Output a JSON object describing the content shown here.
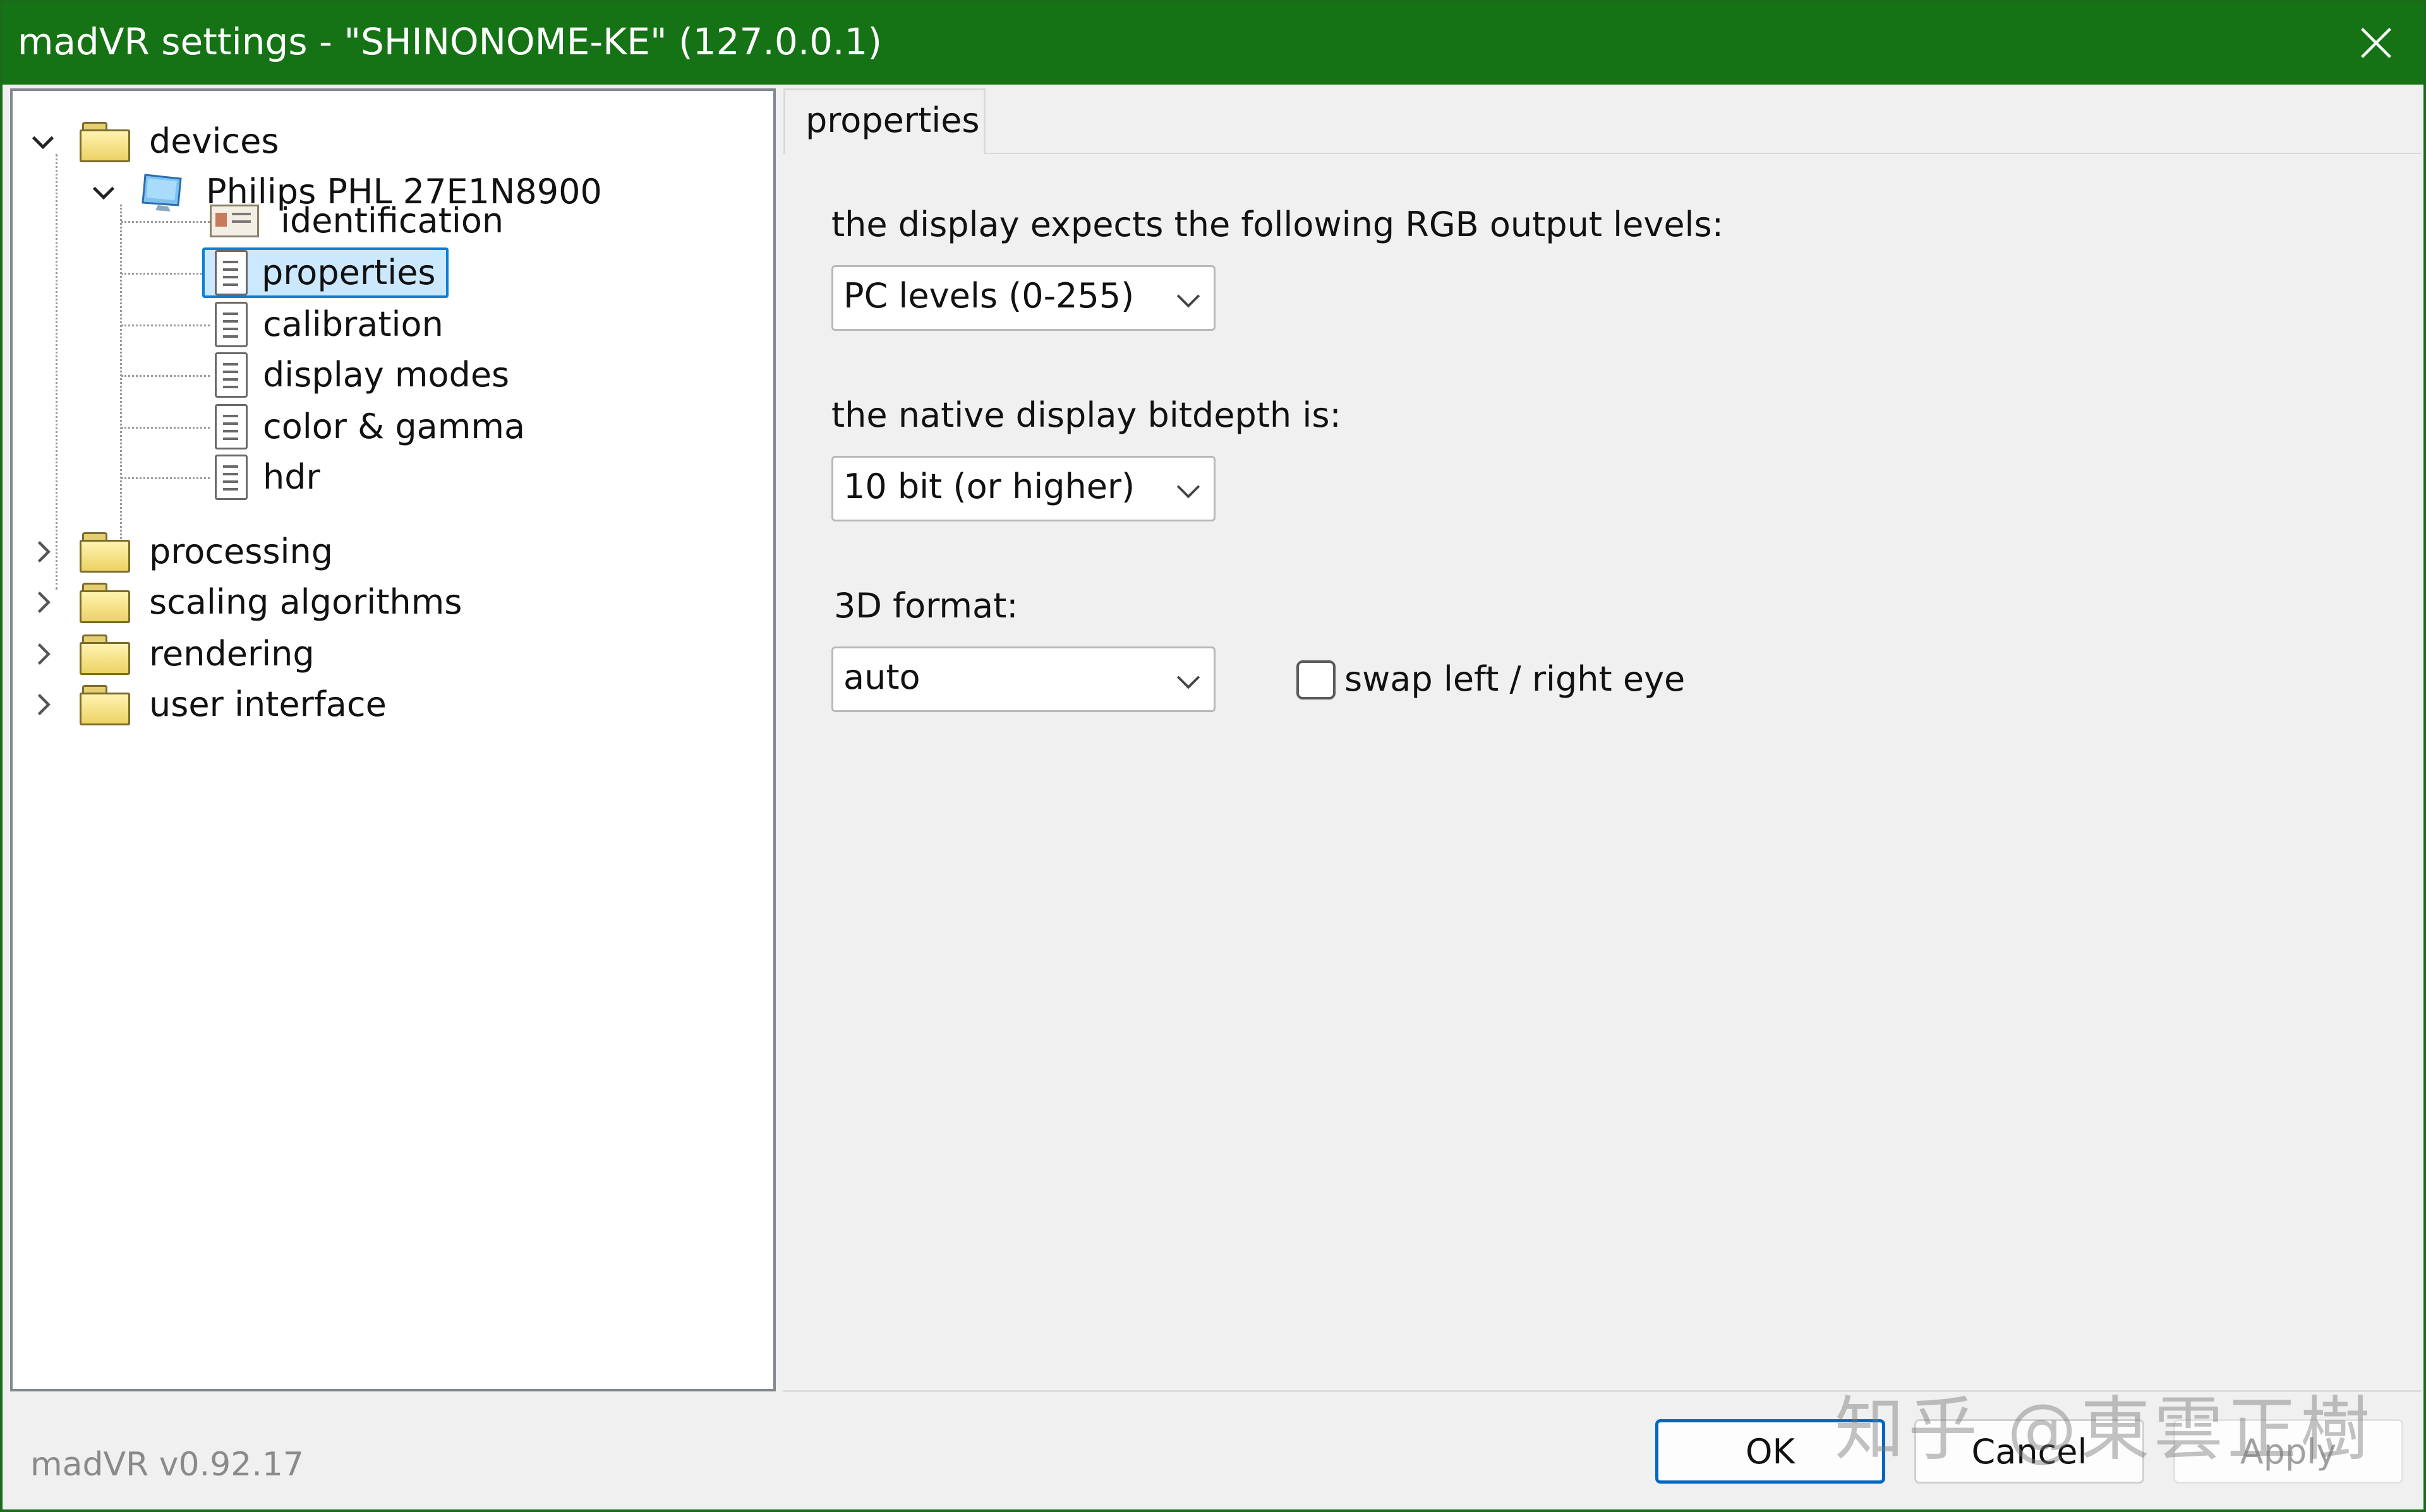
{
  "window": {
    "title": "madVR settings - \"SHINONOME-KE\" (127.0.0.1)",
    "title_bar_color": "#157315"
  },
  "tree": {
    "root": "devices",
    "device": "Philips PHL 27E1N8900",
    "device_children": [
      "identification",
      "properties",
      "calibration",
      "display modes",
      "color & gamma",
      "hdr"
    ],
    "selected": "properties",
    "other_roots": [
      "processing",
      "scaling algorithms",
      "rendering",
      "user interface"
    ]
  },
  "tab": {
    "label": "properties"
  },
  "form": {
    "rgb_label": "the display expects the following RGB output levels:",
    "rgb_value": "PC levels (0-255)",
    "bitdepth_label": "the native display bitdepth is:",
    "bitdepth_value": "10 bit (or higher)",
    "format3d_label": "3D format:",
    "format3d_value": "auto",
    "swap_label": "swap left / right eye",
    "swap_checked": false
  },
  "footer": {
    "version": "madVR v0.92.17",
    "ok": "OK",
    "cancel": "Cancel",
    "apply": "Apply",
    "watermark": "知乎 @東雲正樹"
  },
  "colors": {
    "accent": "#0067c0",
    "selection_bg": "#cce8ff"
  }
}
